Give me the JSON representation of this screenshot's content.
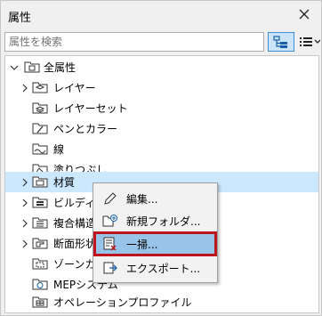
{
  "panel": {
    "title": "属性"
  },
  "search": {
    "placeholder": "属性を検索"
  },
  "tree": {
    "root_label": "全属性",
    "items": [
      {
        "label": "レイヤー"
      },
      {
        "label": "レイヤーセット"
      },
      {
        "label": "ペンとカラー"
      },
      {
        "label": "線"
      },
      {
        "label": "塗りつぶし"
      },
      {
        "label": "材質"
      },
      {
        "label": "ビルディング"
      },
      {
        "label": "複合構造"
      },
      {
        "label": "断面形状"
      },
      {
        "label": "ゾーンカテ"
      },
      {
        "label": "MEPシステム"
      },
      {
        "label": "オペレーションプロファイル"
      }
    ]
  },
  "context_menu": {
    "items": [
      {
        "label": "編集..."
      },
      {
        "label": "新規フォルダ..."
      },
      {
        "label": "一掃..."
      },
      {
        "label": "エクスポート..."
      }
    ]
  },
  "colors": {
    "selection": "#cce8ff",
    "menu_highlight": "#99c4ea",
    "highlight_border": "#c0141c"
  }
}
